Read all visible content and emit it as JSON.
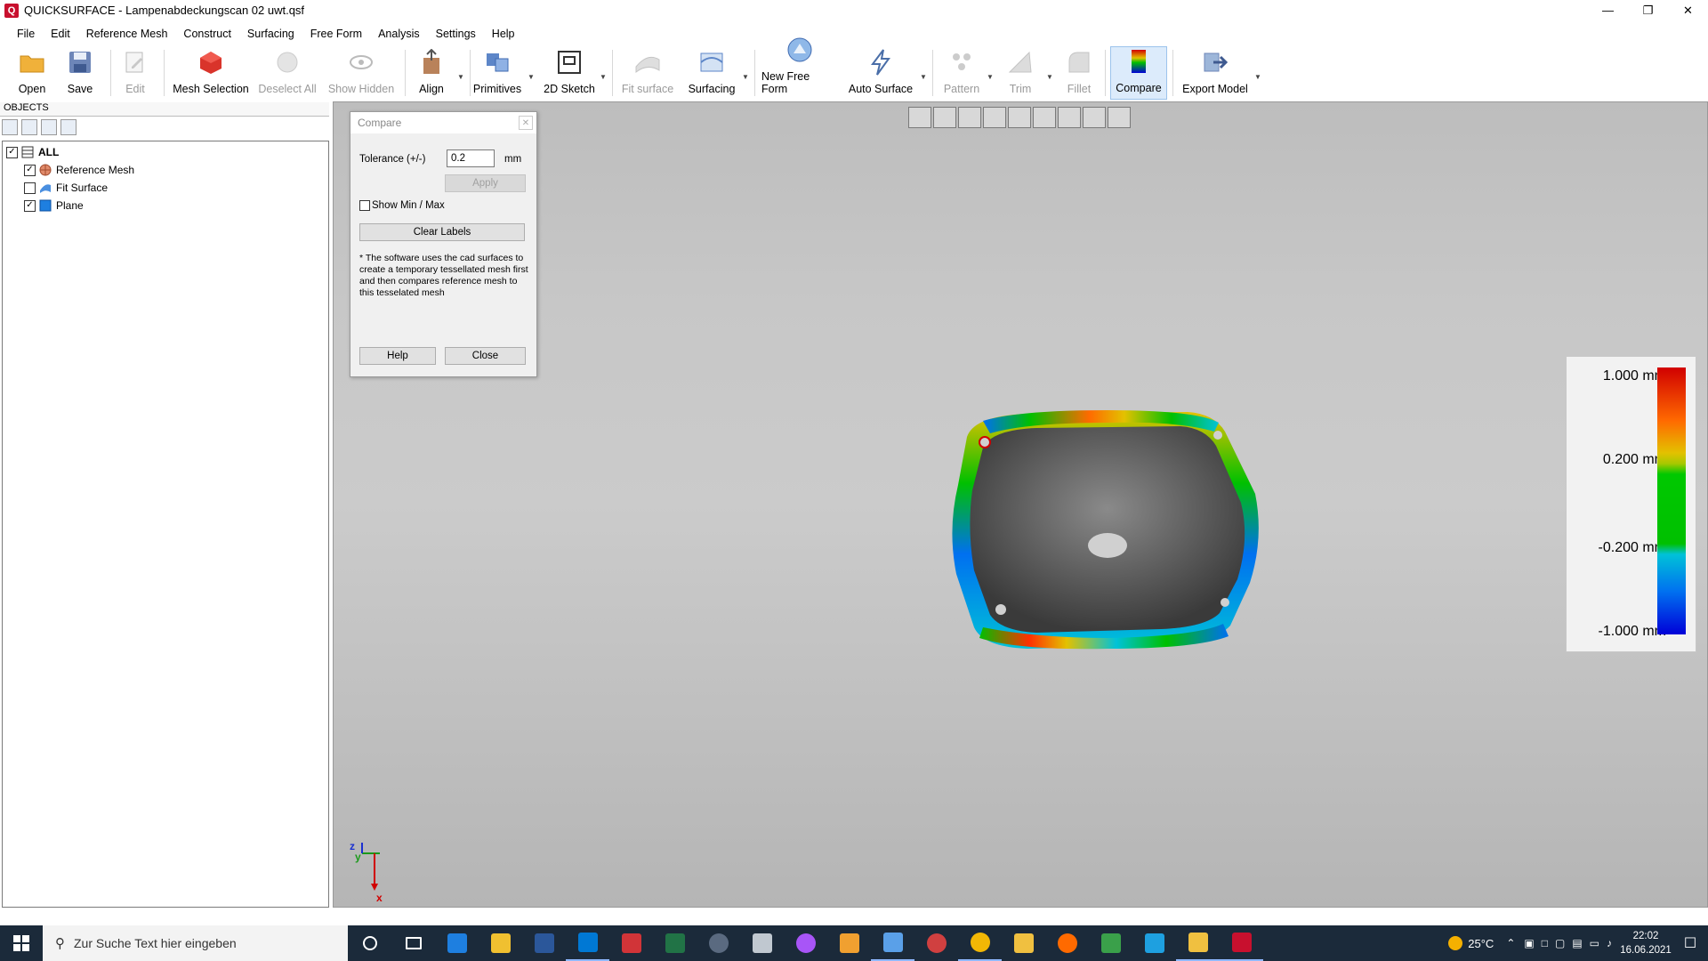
{
  "window": {
    "title": "QUICKSURFACE - Lampenabdeckungscan 02 uwt.qsf",
    "app_icon_letter": "Q"
  },
  "menu": [
    "File",
    "Edit",
    "Reference Mesh",
    "Construct",
    "Surfacing",
    "Free Form",
    "Analysis",
    "Settings",
    "Help"
  ],
  "toolbar": {
    "open": "Open",
    "save": "Save",
    "edit": "Edit",
    "mesh_selection": "Mesh Selection",
    "deselect_all": "Deselect All",
    "show_hidden": "Show Hidden",
    "align": "Align",
    "primitives": "Primitives",
    "sketch_2d": "2D Sketch",
    "fit_surface": "Fit surface",
    "surfacing": "Surfacing",
    "new_free_form": "New Free Form",
    "auto_surface": "Auto Surface",
    "pattern": "Pattern",
    "trim": "Trim",
    "fillet": "Fillet",
    "compare": "Compare",
    "export_model": "Export Model"
  },
  "objects_panel": {
    "header": "OBJECTS",
    "items": [
      {
        "label": "ALL",
        "checked": true
      },
      {
        "label": "Reference Mesh",
        "checked": true
      },
      {
        "label": "Fit Surface",
        "checked": false
      },
      {
        "label": "Plane",
        "checked": true
      }
    ]
  },
  "compare_dialog": {
    "title": "Compare",
    "tolerance_label": "Tolerance (+/-)",
    "tolerance_value": "0.2",
    "unit": "mm",
    "apply_label": "Apply",
    "show_min_max_label": "Show Min / Max",
    "clear_labels_label": "Clear Labels",
    "note": "* The software uses the cad surfaces to create a temporary tessellated mesh first and then compares reference mesh to this tesselated mesh",
    "help_label": "Help",
    "close_label": "Close"
  },
  "legend": {
    "labels": [
      "1.000 mm",
      "0.200 mm",
      "-0.200 mm",
      "-1.000 mm"
    ],
    "colors": {
      "max": "#d10000",
      "tol_high": "#e3c100",
      "in_tol": "#00c000",
      "tol_low": "#00c2d8",
      "min": "#0000d8"
    }
  },
  "axis": {
    "z": "z",
    "y": "y",
    "x": "x"
  },
  "taskbar": {
    "search_placeholder": "Zur Suche Text hier eingeben",
    "temperature": "25°C",
    "time": "22:02",
    "date": "16.06.2021"
  },
  "colors": {
    "accent": "#0078d7",
    "taskbar": "#1b2a3a",
    "brand_red": "#c8102e"
  }
}
